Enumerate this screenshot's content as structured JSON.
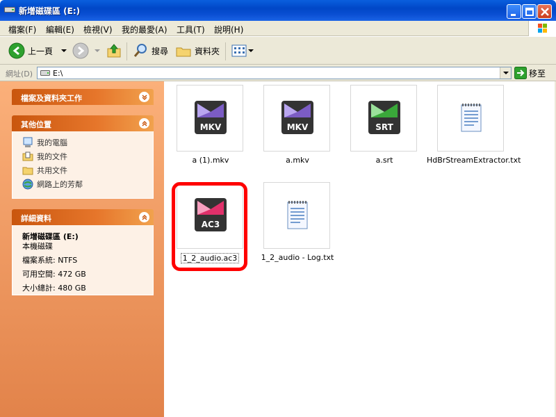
{
  "window": {
    "title": "新增磁碟區 (E:)"
  },
  "menu": [
    {
      "label": "檔案(F)"
    },
    {
      "label": "編輯(E)"
    },
    {
      "label": "檢視(V)"
    },
    {
      "label": "我的最愛(A)"
    },
    {
      "label": "工具(T)"
    },
    {
      "label": "說明(H)"
    }
  ],
  "toolbar": {
    "back_label": "上一頁",
    "search_label": "搜尋",
    "folders_label": "資料夾"
  },
  "address": {
    "label": "網址(D)",
    "value": "E:\\",
    "go_label": "移至"
  },
  "tasks": {
    "file_folder_tasks_title": "檔案及資料夾工作",
    "other_places_title": "其他位置",
    "other_places": [
      {
        "label": "我的電腦",
        "icon": "computer-icon"
      },
      {
        "label": "我的文件",
        "icon": "documents-icon"
      },
      {
        "label": "共用文件",
        "icon": "shared-folder-icon"
      },
      {
        "label": "網路上的芳鄰",
        "icon": "network-icon"
      }
    ],
    "details_title": "詳細資料",
    "details": {
      "name": "新增磁碟區 (E:)",
      "type": "本機磁碟",
      "filesystem": "檔案系統: NTFS",
      "free": "可用空間: 472 GB",
      "total": "大小總計: 480 GB"
    }
  },
  "files": [
    {
      "name": "a (1).mkv",
      "badge": "MKV",
      "kind": "media",
      "accent": "#7b5cc4"
    },
    {
      "name": "a.mkv",
      "badge": "MKV",
      "kind": "media",
      "accent": "#7b5cc4"
    },
    {
      "name": "a.srt",
      "badge": "SRT",
      "kind": "media",
      "accent": "#3aa83a"
    },
    {
      "name": "HdBrStreamExtractor.txt",
      "badge": "",
      "kind": "text",
      "accent": "#4a7fc0"
    },
    {
      "name": "1_2_audio.ac3",
      "badge": "AC3",
      "kind": "media",
      "accent": "#e0306a",
      "selected": true
    },
    {
      "name": "1_2_audio - Log.txt",
      "badge": "",
      "kind": "text",
      "accent": "#4a7fc0"
    }
  ],
  "colors": {
    "highlight": "#ff0000",
    "task_pane": "#e2834a",
    "title_bar": "#0047c7"
  }
}
